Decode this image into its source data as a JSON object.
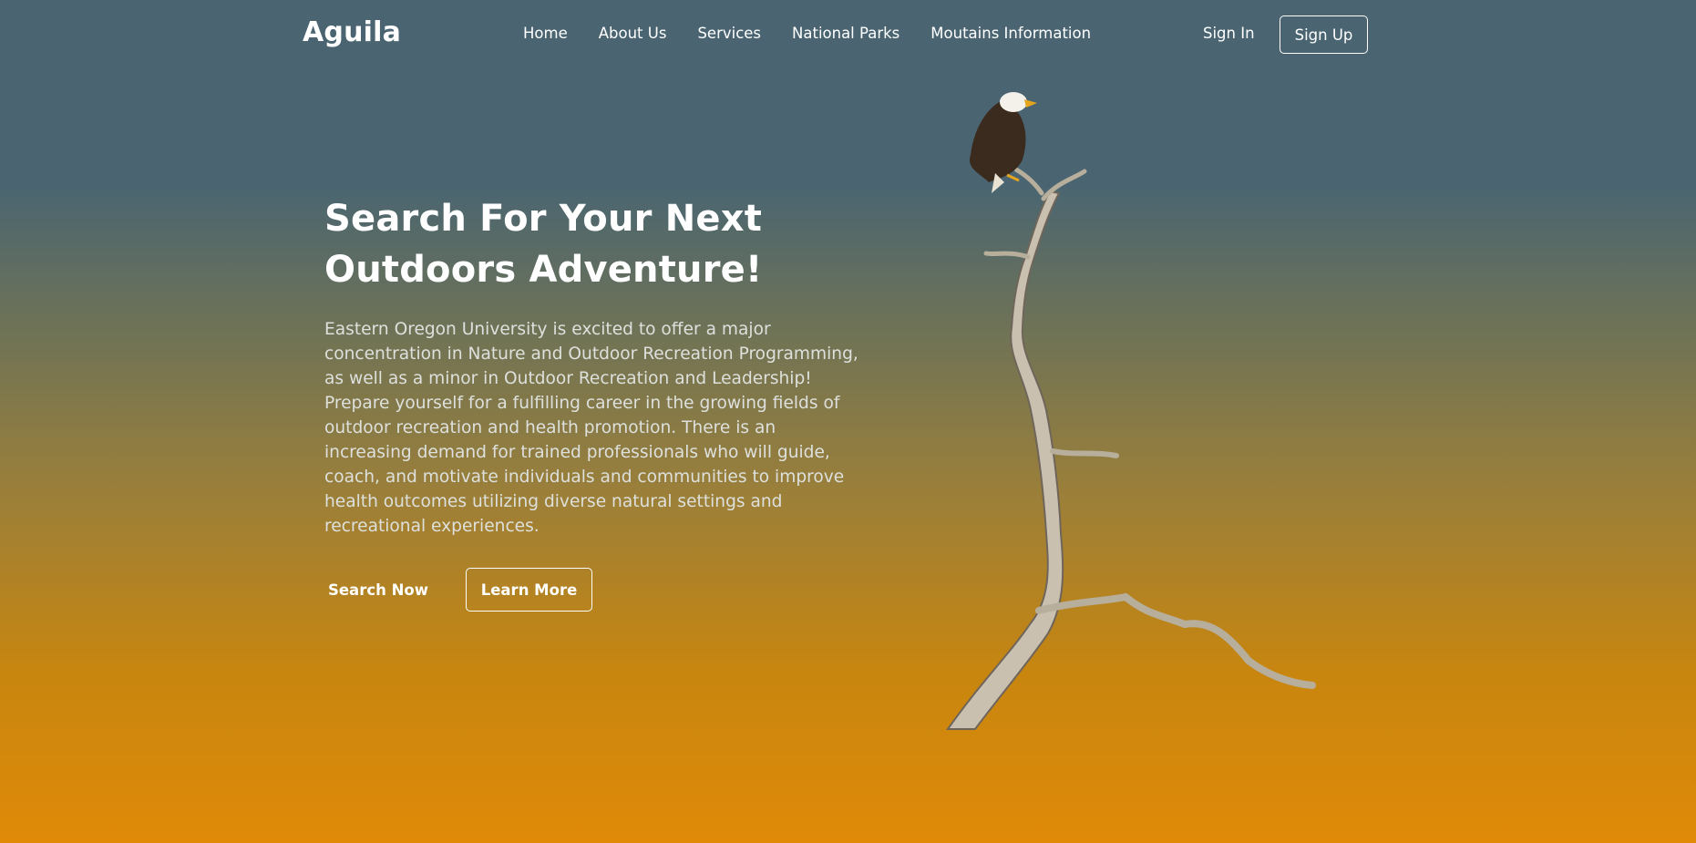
{
  "brand": {
    "logo": "Aguila"
  },
  "nav": {
    "links": [
      "Home",
      "About Us",
      "Services",
      "National Parks",
      "Moutains Information"
    ],
    "sign_in": "Sign In",
    "sign_up": "Sign Up"
  },
  "hero": {
    "title_line1": "Search For Your Next",
    "title_line2": "Outdoors Adventure!",
    "description": "Eastern Oregon University is excited to offer a major concentration in Nature and Outdoor Recreation Programming, as well as a minor in Outdoor Recreation and Leadership! Prepare yourself for a fulfilling career in the growing fields of outdoor recreation and health promotion. There is an increasing demand for trained professionals who will guide, coach, and motivate individuals and communities to improve health outcomes utilizing diverse natural settings and recreational experiences.",
    "primary_button": "Search Now",
    "secondary_button": "Learn More"
  },
  "colors": {
    "top": "#4a6571",
    "bottom": "#e08a08",
    "text": "#ffffff"
  }
}
